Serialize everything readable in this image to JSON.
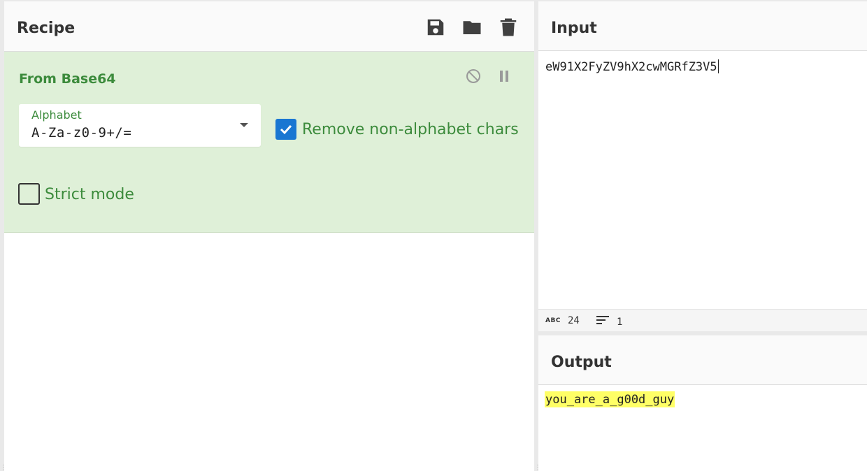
{
  "recipe": {
    "title": "Recipe",
    "icons": [
      "save-icon",
      "folder-icon",
      "trash-icon"
    ]
  },
  "operation": {
    "title": "From Base64",
    "alphabet": {
      "label": "Alphabet",
      "value": "A-Za-z0-9+/="
    },
    "remove_non_alphabet": {
      "label": "Remove non-alphabet chars",
      "checked": true
    },
    "strict_mode": {
      "label": "Strict mode",
      "checked": false
    }
  },
  "input": {
    "title": "Input",
    "text": "eW91X2FyZV9hX2cwMGRfZ3V5",
    "stats": {
      "chars_label": "ABC",
      "chars": "24",
      "lines": "1"
    }
  },
  "output": {
    "title": "Output",
    "text": "you_are_a_g00d_guy"
  },
  "colors": {
    "operation_bg": "#dff0d8",
    "operation_text": "#3c8b3c",
    "checkbox_checked": "#1976d2",
    "output_highlight": "#ffff66"
  }
}
